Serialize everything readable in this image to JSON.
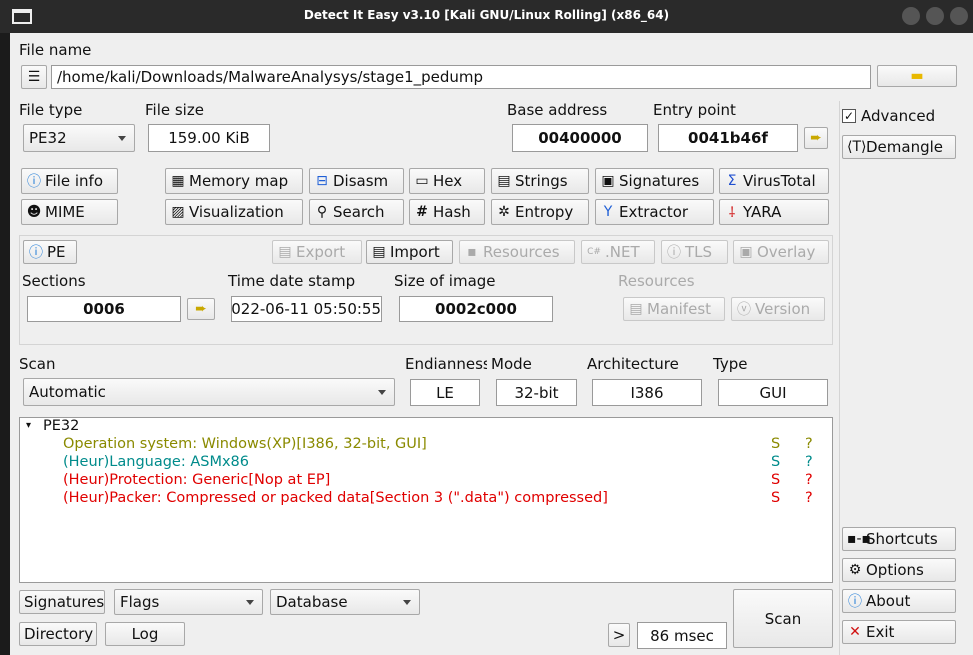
{
  "window": {
    "title": "Detect It Easy v3.10 [Kali GNU/Linux Rolling] (x86_64)"
  },
  "file": {
    "label": "File name",
    "path": "/home/kali/Downloads/MalwareAnalysys/stage1_pedump"
  },
  "info": {
    "file_type_label": "File type",
    "file_type": "PE32",
    "file_size_label": "File size",
    "file_size": "159.00 KiB",
    "base_address_label": "Base address",
    "base_address": "00400000",
    "entry_point_label": "Entry point",
    "entry_point": "0041b46f"
  },
  "side": {
    "advanced": "Advanced",
    "demangle": "Demangle",
    "shortcuts": "Shortcuts",
    "options": "Options",
    "about": "About",
    "exit": "Exit"
  },
  "tools": {
    "file_info": "File info",
    "memory_map": "Memory map",
    "disasm": "Disasm",
    "hex": "Hex",
    "strings": "Strings",
    "signatures": "Signatures",
    "virustotal": "VirusTotal",
    "mime": "MIME",
    "visualization": "Visualization",
    "search": "Search",
    "hash": "Hash",
    "entropy": "Entropy",
    "extractor": "Extractor",
    "yara": "YARA"
  },
  "pe": {
    "pe": "PE",
    "export": "Export",
    "import": "Import",
    "resources": "Resources",
    "net": ".NET",
    "tls": "TLS",
    "overlay": "Overlay",
    "sections_label": "Sections",
    "sections": "0006",
    "time_label": "Time date stamp",
    "time": "2022-06-11 05:50:55",
    "size_label": "Size of image",
    "size": "0002c000",
    "resources_label": "Resources",
    "manifest": "Manifest",
    "version": "Version"
  },
  "scan": {
    "scan_label": "Scan",
    "scan_mode": "Automatic",
    "endianness_label": "Endianness",
    "endianness": "LE",
    "mode_label": "Mode",
    "mode": "32-bit",
    "arch_label": "Architecture",
    "arch": "I386",
    "type_label": "Type",
    "type": "GUI"
  },
  "results": {
    "root": "PE32",
    "lines": [
      {
        "text": "Operation system: Windows(XP)[I386, 32-bit, GUI]",
        "s": "S",
        "q": "?"
      },
      {
        "text": "(Heur)Language: ASMx86",
        "s": "S",
        "q": "?"
      },
      {
        "text": "(Heur)Protection: Generic[Nop at EP]",
        "s": "S",
        "q": "?"
      },
      {
        "text": "(Heur)Packer: Compressed or packed data[Section 3 (\".data\") compressed]",
        "s": "S",
        "q": "?"
      }
    ]
  },
  "bottom": {
    "signatures": "Signatures",
    "flags": "Flags",
    "database": "Database",
    "directory": "Directory",
    "log": "Log",
    "more": ">",
    "time": "86 msec",
    "scan": "Scan"
  },
  "colors": {
    "titlebar": "#2a2a2a",
    "window_bg": "#efefef",
    "os_text": "#8a8a00",
    "lang_text": "#008b8b",
    "heur_text": "#e00000"
  },
  "icons": [
    "window-icon",
    "list-icon",
    "folder-icon",
    "arrow-right-icon",
    "info-icon",
    "memory-icon",
    "disasm-icon",
    "hex-icon",
    "strings-icon",
    "signatures-icon",
    "virustotal-icon",
    "mime-icon",
    "visualization-icon",
    "search-icon",
    "hash-icon",
    "entropy-icon",
    "extractor-icon",
    "yara-icon",
    "gear-icon",
    "close-icon",
    "shortcuts-icon",
    "checkbox-icon",
    "chevron-down-icon"
  ]
}
